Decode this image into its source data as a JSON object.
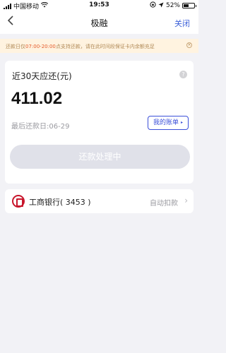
{
  "status_bar": {
    "carrier": "中国移动",
    "time": "19:53",
    "battery": "52%",
    "battery_level": 0.52
  },
  "nav": {
    "back_icon": "chevron-left-icon",
    "title": "极融",
    "close_label": "关闭"
  },
  "notice": {
    "text_before": "还款日仅",
    "highlight": "07:00-20:00",
    "text_after": "点支持还款，请在此时间段保证卡内余额充足",
    "close_icon": "×"
  },
  "repayment": {
    "label": "近30天应还(元)",
    "help_icon": "?",
    "amount": "411.02",
    "due_date": "最后还款日:06-29",
    "bill_button": "我的账单",
    "bill_caret": "▸",
    "action_button": "还款处理中"
  },
  "bank": {
    "name": "工商银行( 3453 )",
    "mode": "自动扣款",
    "chevron": "›",
    "brand_color": "#c8162c"
  },
  "colors": {
    "accent": "#3b4fd9",
    "notice_bg": "#fff3e0",
    "notice_highlight": "#e45a2a",
    "disabled_button": "#e0e1e9"
  }
}
